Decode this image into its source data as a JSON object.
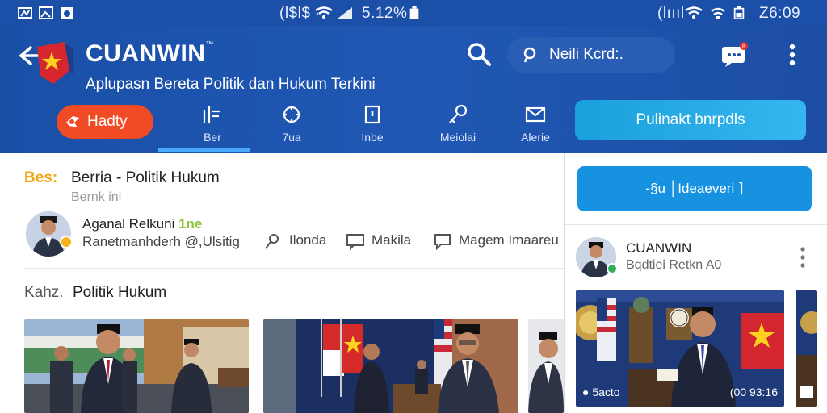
{
  "status_bar": {
    "left_text": "(l$l$ ∙",
    "battery": "5.12%",
    "right_text": "(lıııl",
    "time": "Z6:09"
  },
  "header": {
    "title": "CUANWIN",
    "title_mark": "™",
    "subtitle": "Aplupasn Bereta Politik dan Hukum Terkini",
    "search_placeholder": "Neili Kcrd:.",
    "hot_button": "Hadty",
    "tabs": [
      {
        "label": "Ber",
        "icon": "chart-icon"
      },
      {
        "label": "7ua",
        "icon": "globe-icon"
      },
      {
        "label": "Inbe",
        "icon": "info-icon"
      },
      {
        "label": "Meiolai",
        "icon": "key-icon"
      },
      {
        "label": "Alerie",
        "icon": "mail-icon"
      }
    ],
    "follow_button": "Pulinakt bnrpdls",
    "notification_count": "8"
  },
  "article": {
    "breadcrumb_label": "Bes:",
    "breadcrumb_title": "Berria - Politik Hukum",
    "breadcrumb_sub": "Bernk ini",
    "author_name": "Aganal Relkuni",
    "author_badge": "1ne",
    "author_meta": "Ranetmanhderh @,Ulsitig",
    "actions": [
      {
        "label": "Ilonda",
        "icon": "pin-icon"
      },
      {
        "label": "Makila",
        "icon": "comment-icon"
      },
      {
        "label": "Magem  Imaareu",
        "icon": "chat-icon"
      }
    ],
    "section_label": "Kahz.",
    "section_title": "Politik Hukum"
  },
  "side": {
    "button_label": "-§u  │Ideaeveri ⌉",
    "channel_name": "CUANWIN",
    "channel_meta": "Bqdtiei Retkn A0",
    "card_caption_left": "● 5acto",
    "card_caption_right": "(00 93:16"
  },
  "colors": {
    "header_blue": "#1a4fa6",
    "hot_red": "#f04b24",
    "follow_cyan": "#1aa0db",
    "side_btn_blue": "#1792e0",
    "accent_gold": "#f2a81d"
  }
}
